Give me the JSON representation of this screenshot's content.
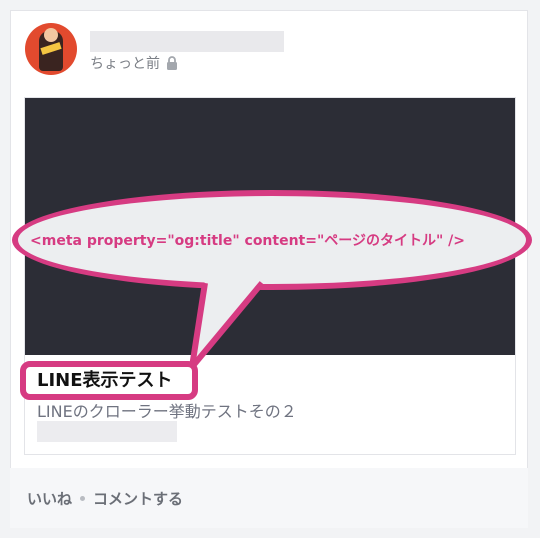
{
  "post": {
    "time": "ちょっと前",
    "visibility_icon": "lock-icon"
  },
  "link_preview": {
    "title": "LINE表示テスト",
    "description": "LINEのクローラー挙動テストその２"
  },
  "footer": {
    "like_label": "いいね",
    "comment_label": "コメントする"
  },
  "annotation": {
    "text": "<meta property=\"og:title\" content=\"ページのタイトル\" />"
  },
  "colors": {
    "accent": "#d63b82",
    "image_bg": "#2c2d36"
  }
}
